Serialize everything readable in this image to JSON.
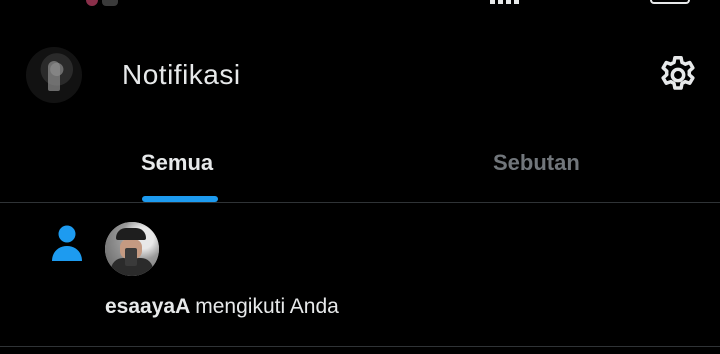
{
  "header": {
    "title": "Notifikasi"
  },
  "tabs": [
    {
      "label": "Semua",
      "active": true
    },
    {
      "label": "Sebutan",
      "active": false
    }
  ],
  "notifications": [
    {
      "type": "follow",
      "icon": "person-icon",
      "username": "esaayaA",
      "action": "mengikuti Anda"
    }
  ],
  "colors": {
    "background": "#000000",
    "text": "#e7e9ea",
    "muted": "#71767b",
    "accent": "#1d9bf0",
    "divider": "#2f3336"
  },
  "icons": {
    "settings": "gear-icon",
    "follow": "person-icon"
  }
}
